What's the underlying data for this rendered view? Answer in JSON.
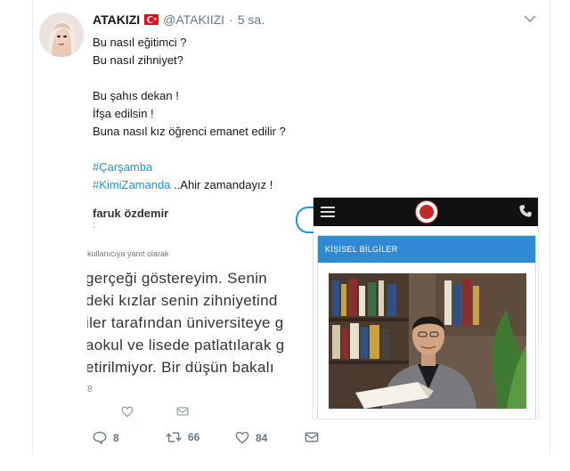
{
  "tweet": {
    "author_name": "ATAKIZI",
    "author_handle": "@ATAKIIZI",
    "separator": "·",
    "time": "5 sa.",
    "lines": [
      "Bu nasıl eğitimci ?",
      "Bu nasıl zihniyet?",
      "",
      "Bu şahıs dekan !",
      "İfşa edilsin !",
      "Buna nasıl kız öğrenci emanet edilir ?",
      ""
    ],
    "hashtag1": "#Çarşamba",
    "hashtag2": "#KimiZamanda",
    "hashtag2_suffix": " ..Ahir zamandayız !"
  },
  "embedded_reply": {
    "name": "faruk özdemir",
    "sub": ":",
    "reply_note": "kullanıcıya yanıt olarak",
    "body_lines": [
      "gerçeği göstereyim. Senin",
      "deki kızlar senin zihniyetind",
      "iler tarafından üniversiteye g",
      "aokul ve lisede patlatılarak g",
      "etirilmiyor. Bir düşün bakalı"
    ],
    "time_fragment": "8"
  },
  "embedded_profile": {
    "panel_title": "KİŞİSEL BİLGİLER"
  },
  "actions": {
    "replies": "8",
    "retweets": "66",
    "likes": "84"
  },
  "colors": {
    "link": "#1b95e0",
    "muted": "#657786",
    "panel_blue": "#2f89d3"
  }
}
